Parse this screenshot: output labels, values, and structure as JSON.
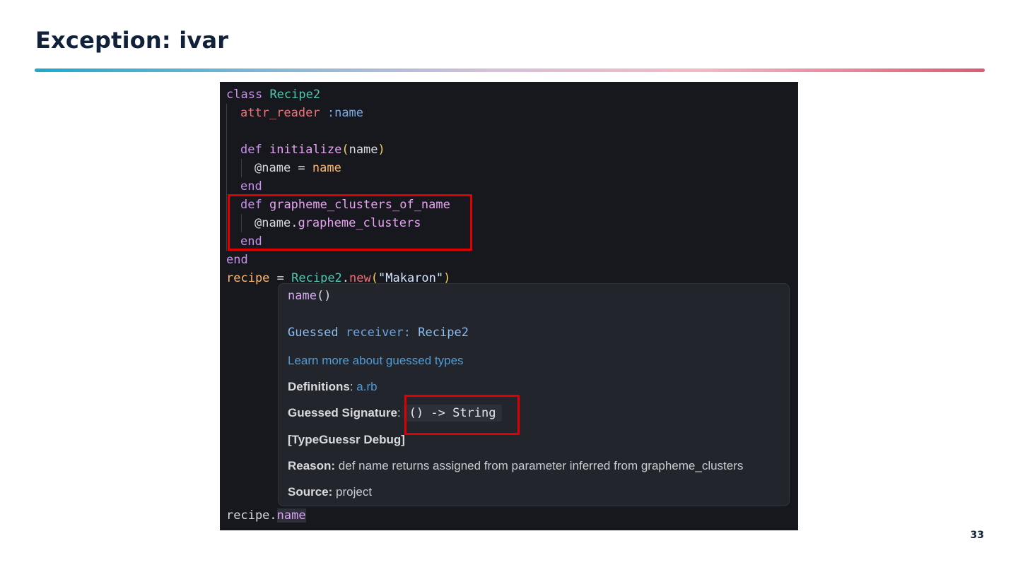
{
  "slide": {
    "title": "Exception: ivar",
    "page_number": "33"
  },
  "code": {
    "l1": {
      "kw": "class",
      "cls": "Recipe2"
    },
    "l2": {
      "attr": "attr_reader",
      "sym": ":name"
    },
    "l4": {
      "kw": "def",
      "meth": "initialize",
      "open": "(",
      "arg": "name",
      "close": ")"
    },
    "l5": {
      "ivar": "@name",
      "eq": " = ",
      "val": "name"
    },
    "l6": {
      "kw": "end"
    },
    "l7": {
      "kw": "def",
      "meth": "grapheme_clusters_of_name"
    },
    "l8": {
      "ivar": "@name",
      "dot": ".",
      "call": "grapheme_clusters"
    },
    "l9": {
      "kw": "end"
    },
    "l10": {
      "kw": "end"
    },
    "l11": {
      "var": "recipe",
      "eq": " = ",
      "cls": "Recipe2",
      "dot": ".",
      "call": "new",
      "open": "(",
      "str": "\"Makaron\"",
      "close": ")"
    },
    "last": {
      "recv": "recipe.",
      "method": "name"
    }
  },
  "hover": {
    "signature_name": "name",
    "signature_parens": "()",
    "guessed_label": "Guessed",
    "receiver_label": "receiver:",
    "receiver_type": "Recipe2",
    "learn_more": "Learn more about guessed types",
    "definitions_label": "Definitions",
    "definitions_colon": ": ",
    "definitions_file": "a.rb",
    "guessed_signature_label": "Guessed Signature",
    "guessed_signature_colon": ":",
    "guessed_signature_value": "() -> String",
    "debug_heading": "[TypeGuessr Debug]",
    "reason_label": "Reason:",
    "reason_text": " def name returns assigned from parameter inferred from grapheme_clusters",
    "source_label": "Source:",
    "source_text": " project"
  },
  "colors": {
    "editor_bg": "#16181d",
    "hover_bg": "#22252b",
    "highlight_box": "#e00000",
    "keyword": "#c792ea",
    "class_name": "#4ec9b0",
    "link": "#4f9bd8"
  }
}
